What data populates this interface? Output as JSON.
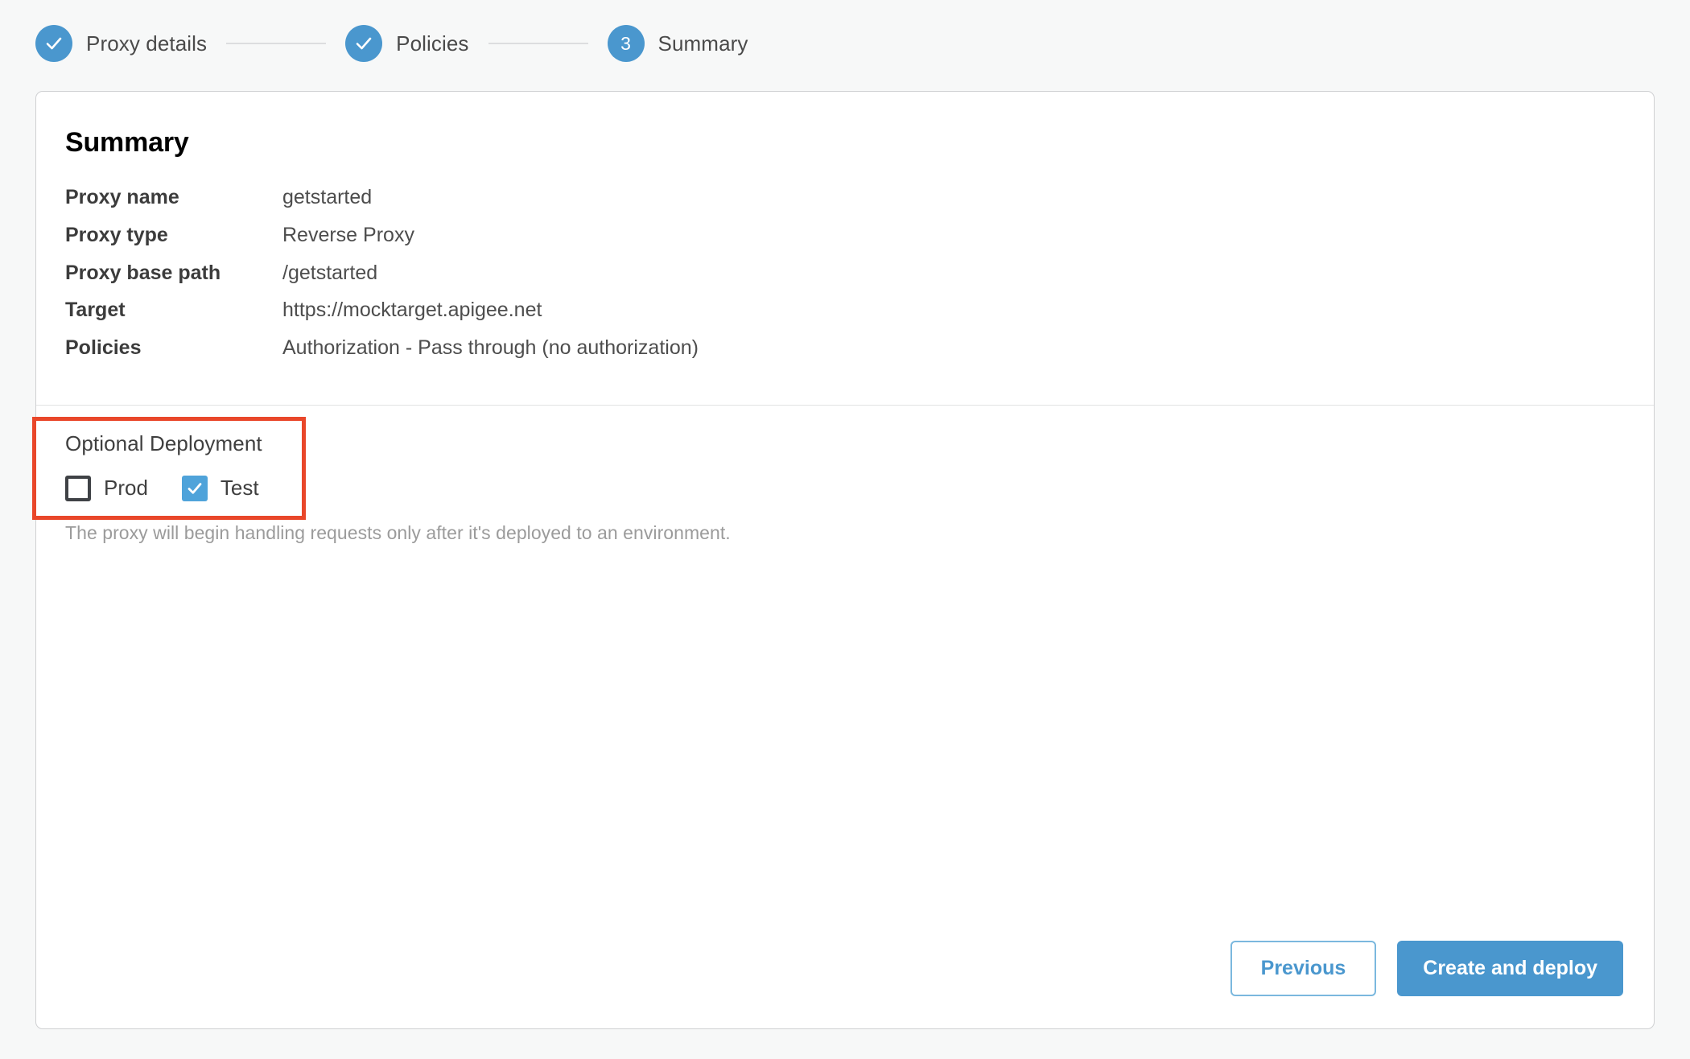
{
  "stepper": {
    "steps": [
      {
        "label": "Proxy details",
        "state": "complete",
        "marker": "check-icon"
      },
      {
        "label": "Policies",
        "state": "complete",
        "marker": "check-icon"
      },
      {
        "label": "Summary",
        "state": "current",
        "marker": "3"
      }
    ]
  },
  "card": {
    "title": "Summary",
    "summary_rows": [
      {
        "label": "Proxy name",
        "value": "getstarted"
      },
      {
        "label": "Proxy type",
        "value": "Reverse Proxy"
      },
      {
        "label": "Proxy base path",
        "value": "/getstarted"
      },
      {
        "label": "Target",
        "value": "https://mocktarget.apigee.net"
      },
      {
        "label": "Policies",
        "value": "Authorization - Pass through (no authorization)"
      }
    ],
    "deployment": {
      "title": "Optional Deployment",
      "checkboxes": [
        {
          "label": "Prod",
          "checked": false
        },
        {
          "label": "Test",
          "checked": true
        }
      ],
      "hint": "The proxy will begin handling requests only after it's deployed to an environment."
    },
    "footer": {
      "previous_label": "Previous",
      "create_label": "Create and deploy"
    }
  },
  "colors": {
    "accent_blue": "#4a97ce",
    "checkbox_blue": "#4fa3da",
    "highlight_red": "#e9472a",
    "page_background": "#f7f8f8",
    "card_border": "#cfd0d2"
  }
}
